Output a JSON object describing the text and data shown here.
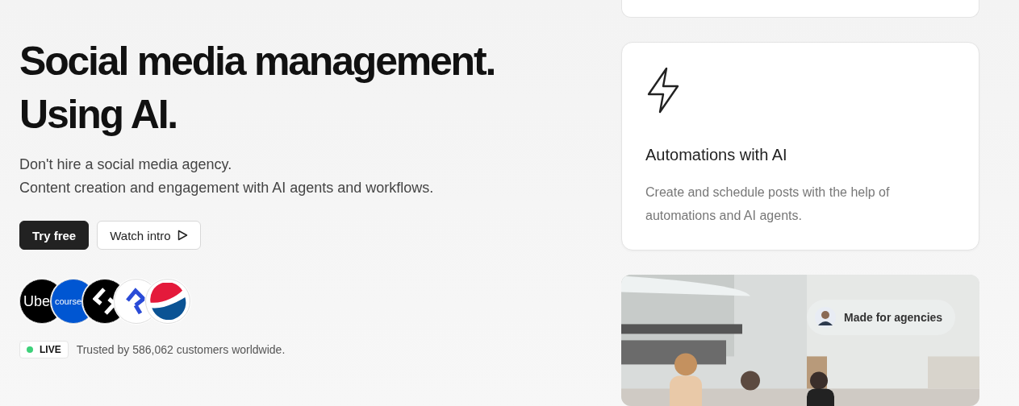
{
  "hero": {
    "headline": [
      "Social media management.",
      "Using AI."
    ],
    "subtitle": [
      "Don't hire a social media agency.",
      "Content creation and engagement with AI agents and workflows."
    ],
    "buttons": [
      {
        "kind": "primary",
        "label": "Try free"
      },
      {
        "kind": "secondary",
        "label": "Watch intro"
      }
    ],
    "logos": [
      {
        "kind": "text",
        "label": "Ube",
        "color": "#000000"
      },
      {
        "kind": "text",
        "label": "course",
        "color": "#0056d2"
      },
      {
        "kind": "chevron",
        "color": "#000000"
      },
      {
        "kind": "mark",
        "color": "#ffffff"
      },
      {
        "kind": "globe",
        "color": "#ffffff"
      }
    ],
    "status": {
      "badge": "LIVE",
      "live": true,
      "text": "Trusted by 586,062 customers worldwide."
    }
  },
  "feature_card": {
    "title": "Automations with AI",
    "description": "Create and schedule posts with the help of automations and AI agents."
  },
  "photo": {
    "kind": "picture",
    "pill": "Made for agencies"
  }
}
